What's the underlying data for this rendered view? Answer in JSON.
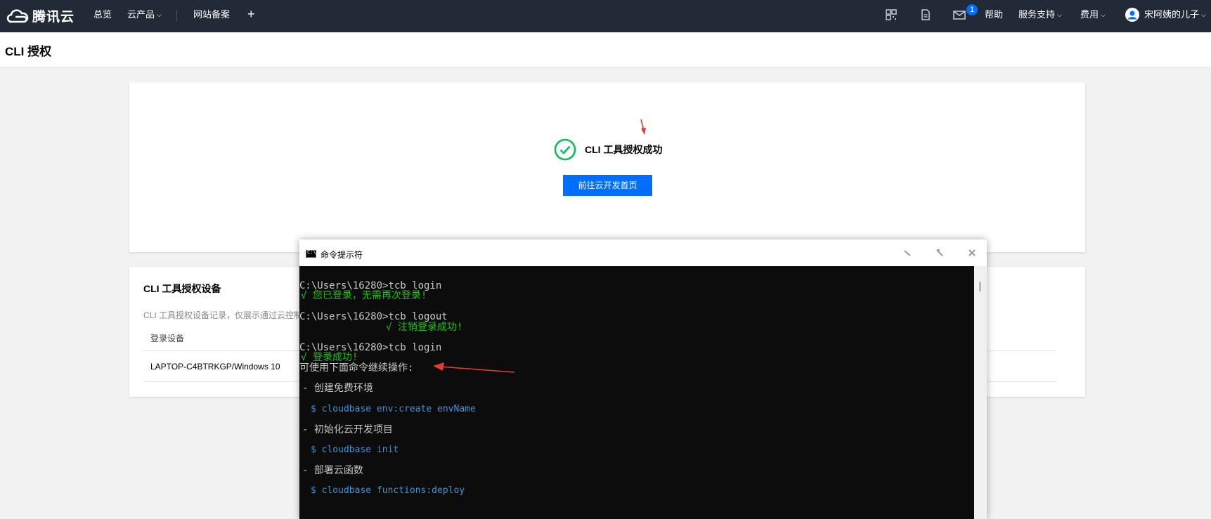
{
  "topbar": {
    "brand": "腾讯云",
    "nav": [
      "总览",
      "云产品",
      "网站备案"
    ],
    "help": "帮助",
    "support": "服务支持",
    "billing": "费用",
    "user": "宋阿姨的儿子",
    "notification_count": "1"
  },
  "page": {
    "title": "CLI 授权"
  },
  "success": {
    "message": "CLI 工具授权成功",
    "button": "前往云开发首页"
  },
  "devices": {
    "title": "CLI 工具授权设备",
    "description": "CLI 工具授权设备记录，仅展示通过云控制",
    "column": "登录设备",
    "rows": [
      "LAPTOP-C4BTRKGP/Windows 10"
    ]
  },
  "console": {
    "title": "命令提示符",
    "lines": [
      "C:\\Users\\16280>tcb login",
      "√ 您已登录，无需再次登录!",
      "C:\\Users\\16280>tcb logout",
      "√ 注销登录成功!",
      "C:\\Users\\16280>tcb login",
      "√ 登录成功!",
      "可使用下面命令继续操作:",
      "- 创建免费环境",
      "$ cloudbase env:create envName",
      "- 初始化云开发项目",
      "$ cloudbase init",
      "- 部署云函数",
      "$ cloudbase functions:deploy"
    ]
  },
  "colors": {
    "topbar": "#222a38",
    "primary": "#006eff",
    "success": "#16c60c",
    "annotation": "#e53935"
  }
}
